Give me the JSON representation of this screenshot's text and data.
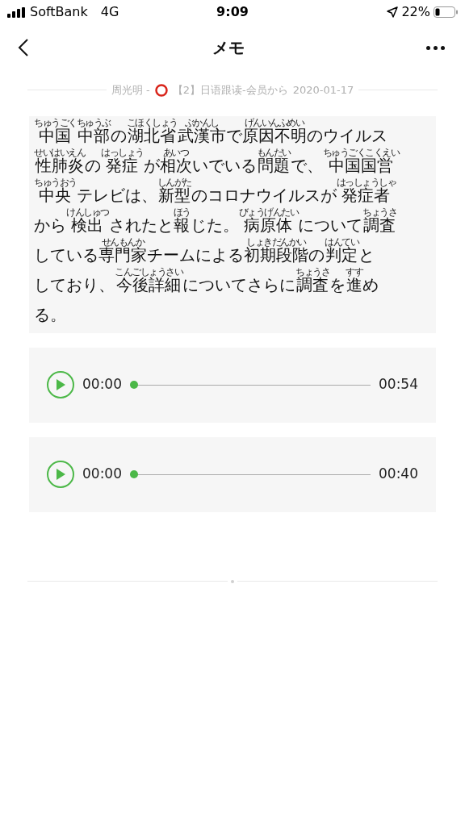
{
  "status_bar": {
    "carrier": "SoftBank",
    "network": "4G",
    "time": "9:09",
    "battery": "22%"
  },
  "nav": {
    "title": "メモ"
  },
  "source": {
    "author": "周光明 -",
    "channel": "【2】日语跟读-会员から",
    "date": "2020-01-17"
  },
  "memo_lines": [
    [
      {
        "text": "中国",
        "ruby": "ちゅうごく"
      },
      {
        "text": "中部",
        "ruby": "ちゅうぶ"
      },
      {
        "text": "の"
      },
      {
        "text": "湖北省",
        "ruby": "こほくしょう"
      },
      {
        "text": "武漢市",
        "ruby": "ぶかんし"
      },
      {
        "text": "で"
      },
      {
        "text": "原因不明",
        "ruby": "げんいんふめい"
      },
      {
        "text": "のウイルス"
      }
    ],
    [
      {
        "text": "性肺炎",
        "ruby": "せいはいえん"
      },
      {
        "text": "の"
      },
      {
        "text": "発症",
        "ruby": "はっしょう"
      },
      {
        "text": "が"
      },
      {
        "text": "相次",
        "ruby": "あいつ"
      },
      {
        "text": "いでいる"
      },
      {
        "text": "問題",
        "ruby": "もんだい"
      },
      {
        "text": "で、"
      },
      {
        "text": "中国国営",
        "ruby": "ちゅうごくこくえい"
      }
    ],
    [
      {
        "text": "中央",
        "ruby": "ちゅうおう"
      },
      {
        "text": "テレビは、"
      },
      {
        "text": "新型",
        "ruby": "しんがた"
      },
      {
        "text": "のコロナウイルスが"
      },
      {
        "text": "発症者",
        "ruby": "はっしょうしゃ"
      }
    ],
    [
      {
        "text": "から"
      },
      {
        "text": "検出",
        "ruby": "けんしゅつ"
      },
      {
        "text": "されたと"
      },
      {
        "text": "報",
        "ruby": "ほう"
      },
      {
        "text": "じた。"
      },
      {
        "text": "病原体",
        "ruby": "びょうげんたい"
      },
      {
        "text": "について"
      },
      {
        "text": "調査",
        "ruby": "ちょうさ"
      }
    ],
    [
      {
        "text": "している"
      },
      {
        "text": "専門家",
        "ruby": "せんもんか"
      },
      {
        "text": "チームによる"
      },
      {
        "text": "初期段階",
        "ruby": "しょきだんかい"
      },
      {
        "text": "の"
      },
      {
        "text": "判定",
        "ruby": "はんてい"
      },
      {
        "text": "と"
      }
    ],
    [
      {
        "text": "しており、"
      },
      {
        "text": "今後詳細",
        "ruby": "こんごしょうさい"
      },
      {
        "text": "についてさらに"
      },
      {
        "text": "調査",
        "ruby": "ちょうさ"
      },
      {
        "text": "を"
      },
      {
        "text": "進",
        "ruby": "すす"
      },
      {
        "text": "め"
      }
    ],
    [
      {
        "text": "る。"
      }
    ]
  ],
  "players": [
    {
      "current": "00:00",
      "duration": "00:54",
      "level": 0
    },
    {
      "current": "00:00",
      "duration": "00:40",
      "level": 0
    }
  ]
}
